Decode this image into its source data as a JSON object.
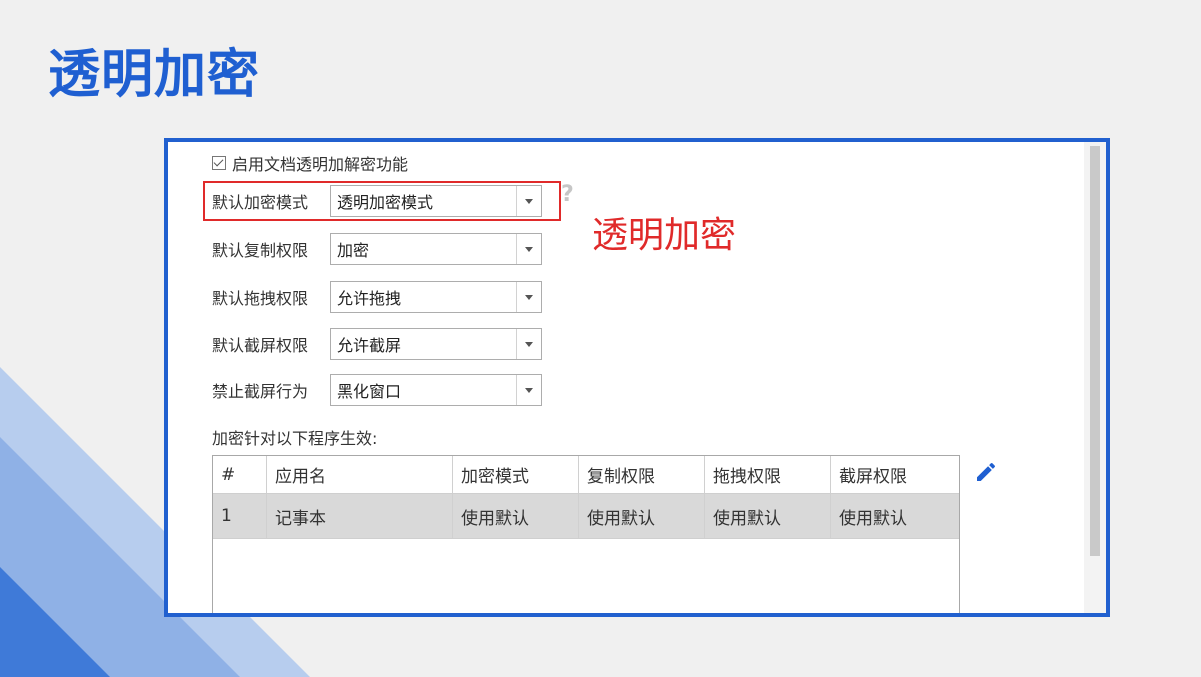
{
  "slide": {
    "title": "透明加密"
  },
  "settings": {
    "enable_label": "启用文档透明加解密功能",
    "rows": [
      {
        "label": "默认加密模式",
        "value": "透明加密模式"
      },
      {
        "label": "默认复制权限",
        "value": "加密"
      },
      {
        "label": "默认拖拽权限",
        "value": "允许拖拽"
      },
      {
        "label": "默认截屏权限",
        "value": "允许截屏"
      },
      {
        "label": "禁止截屏行为",
        "value": "黑化窗口"
      }
    ],
    "help_glyph": "?"
  },
  "annotation": {
    "text": "透明加密",
    "color": "#e02a2a"
  },
  "apps": {
    "label": "加密针对以下程序生效:",
    "columns": [
      "#",
      "应用名",
      "加密模式",
      "复制权限",
      "拖拽权限",
      "截屏权限"
    ],
    "rows": [
      [
        "1",
        "记事本",
        "使用默认",
        "使用默认",
        "使用默认",
        "使用默认"
      ]
    ]
  },
  "icons": {
    "edit": "pencil-icon",
    "dropdown": "chevron-down-icon",
    "help": "question-icon"
  },
  "colors": {
    "accent": "#1f5fd1",
    "frame": "#2160cf",
    "highlight": "#e02a2a"
  }
}
